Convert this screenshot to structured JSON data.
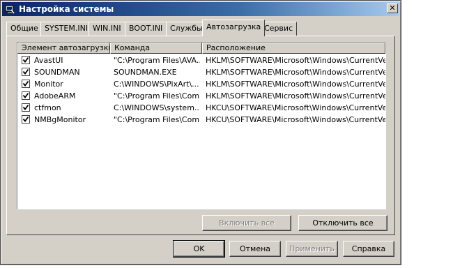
{
  "window": {
    "title": "Настройка системы",
    "close_label": "✕"
  },
  "tabs": [
    {
      "label": "Общие",
      "active": false
    },
    {
      "label": "SYSTEM.INI",
      "active": false
    },
    {
      "label": "WIN.INI",
      "active": false
    },
    {
      "label": "BOOT.INI",
      "active": false
    },
    {
      "label": "Службы",
      "active": false
    },
    {
      "label": "Автозагрузка",
      "active": true
    },
    {
      "label": "Сервис",
      "active": false
    }
  ],
  "startup_list": {
    "columns": [
      "Элемент автозагрузки",
      "Команда",
      "Расположение"
    ],
    "rows": [
      {
        "checked": true,
        "item": "AvastUI",
        "command": "\"C:\\Program Files\\AVA...",
        "location": "HKLM\\SOFTWARE\\Microsoft\\Windows\\CurrentVer..."
      },
      {
        "checked": true,
        "item": "SOUNDMAN",
        "command": "SOUNDMAN.EXE",
        "location": "HKLM\\SOFTWARE\\Microsoft\\Windows\\CurrentVer..."
      },
      {
        "checked": true,
        "item": "Monitor",
        "command": "C:\\WINDOWS\\PixArt\\...",
        "location": "HKLM\\SOFTWARE\\Microsoft\\Windows\\CurrentVer..."
      },
      {
        "checked": true,
        "item": "AdobeARM",
        "command": "\"C:\\Program Files\\Com...",
        "location": "HKLM\\SOFTWARE\\Microsoft\\Windows\\CurrentVer..."
      },
      {
        "checked": true,
        "item": "ctfmon",
        "command": "C:\\WINDOWS\\system...",
        "location": "HKCU\\SOFTWARE\\Microsoft\\Windows\\CurrentVer..."
      },
      {
        "checked": true,
        "item": "NMBgMonitor",
        "command": "\"C:\\Program Files\\Com...",
        "location": "HKCU\\SOFTWARE\\Microsoft\\Windows\\CurrentVer..."
      }
    ]
  },
  "panel_buttons": {
    "enable_all": "Включить все",
    "disable_all": "Отключить все"
  },
  "dialog_buttons": {
    "ok": "OK",
    "cancel": "Отмена",
    "apply": "Применить",
    "help": "Справка"
  }
}
